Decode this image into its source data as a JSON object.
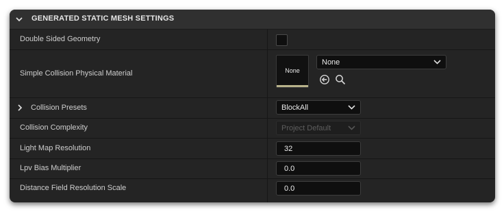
{
  "section": {
    "title": "GENERATED STATIC MESH SETTINGS",
    "collapse_icon": "chevron-down-icon"
  },
  "rows": {
    "double_sided": {
      "label": "Double Sided Geometry",
      "checked": false
    },
    "collision_material": {
      "label": "Simple Collision Physical Material",
      "thumbnail_text": "None",
      "selected": "None",
      "browse_icon": "use-selected-arrow-icon",
      "search_icon": "search-icon"
    },
    "collision_presets": {
      "label": "Collision Presets",
      "value": "BlockAll",
      "expand_icon": "chevron-right-icon"
    },
    "collision_complexity": {
      "label": "Collision Complexity",
      "value": "Project Default",
      "disabled": true
    },
    "light_map_resolution": {
      "label": "Light Map Resolution",
      "value": "32"
    },
    "lpv_bias": {
      "label": "Lpv Bias Multiplier",
      "value": "0.0"
    },
    "distance_field_scale": {
      "label": "Distance Field Resolution Scale",
      "value": "0.0"
    }
  },
  "colors": {
    "panel_bg": "#242424",
    "header_bg": "#303030",
    "field_bg": "#0f0f0f",
    "thumbnail_accent": "#b8b28a"
  }
}
